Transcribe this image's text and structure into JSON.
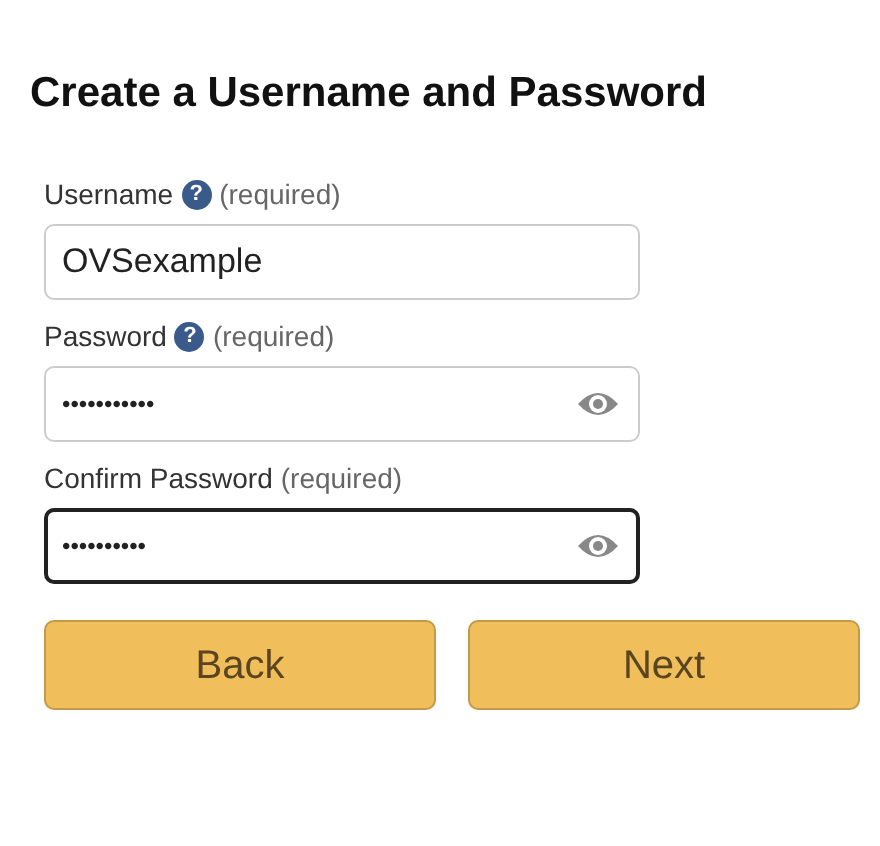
{
  "title": "Create a Username and Password",
  "fields": [
    {
      "label": "Username",
      "help_icon": "?",
      "note": "(required)",
      "value": "OVSexample",
      "kind": "text",
      "focused": false
    },
    {
      "label": "Password",
      "help_icon": "?",
      "note": "(required)",
      "value": "•••••••••••",
      "kind": "password",
      "focused": false
    },
    {
      "label": "Confirm Password",
      "note": "(required)",
      "value": "••••••••••",
      "kind": "password",
      "focused": true
    }
  ],
  "buttons": [
    {
      "label": "Back"
    },
    {
      "label": "Next"
    }
  ]
}
